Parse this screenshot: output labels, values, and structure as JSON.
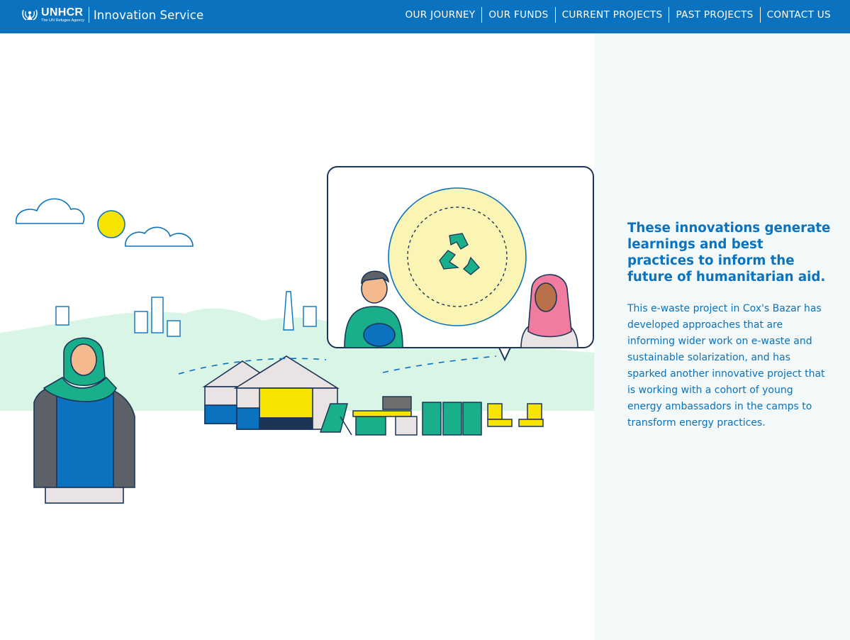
{
  "header": {
    "logo_word": "UNHCR",
    "logo_tagline": "The UN Refugee Agency",
    "service_name": "Innovation Service",
    "nav": [
      {
        "label": "OUR JOURNEY"
      },
      {
        "label": "OUR FUNDS"
      },
      {
        "label": "CURRENT PROJECTS"
      },
      {
        "label": "PAST PROJECTS"
      },
      {
        "label": "CONTACT US"
      }
    ]
  },
  "content": {
    "headline": "These innovations generate learnings and best practices to inform the future of humanitarian aid.",
    "body": "This e-waste project in Cox's Bazar has developed approaches that are informing wider work on e-waste and sustainable solarization, and has sparked another innovative project that is working with a cohort of young energy ambassadors in the camps to transform energy practices."
  },
  "colors": {
    "brand_blue": "#0a72be",
    "panel_bg": "#f3f9f8",
    "hill_green": "#d9f5e6",
    "accent_green": "#1aaf8b",
    "sun_yellow": "#f7e400",
    "outline_navy": "#1c3557",
    "accent_pink": "#f07da0"
  },
  "icons": [
    "unhcr-logo-icon"
  ]
}
